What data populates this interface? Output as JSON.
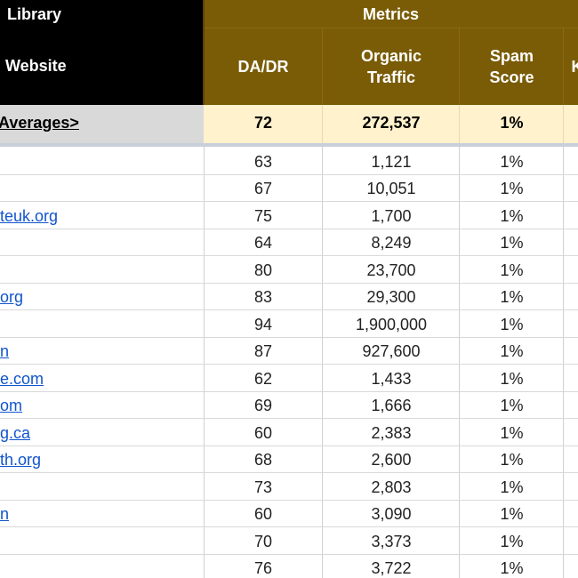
{
  "header": {
    "library_label": "Library",
    "website_label": "Website",
    "metrics_label": "Metrics",
    "columns": [
      {
        "line1": "DA/DR",
        "line2": ""
      },
      {
        "line1": "Organic",
        "line2": "Traffic"
      },
      {
        "line1": "Spam",
        "line2": "Score"
      },
      {
        "line1": "K",
        "line2": ""
      }
    ]
  },
  "averages": {
    "label": "Averages>",
    "da_dr": "72",
    "organic_traffic": "272,537",
    "spam_score": "1%"
  },
  "rows": [
    {
      "website": "",
      "da_dr": "63",
      "traffic": "1,121",
      "spam": "1%"
    },
    {
      "website": "",
      "da_dr": "67",
      "traffic": "10,051",
      "spam": "1%"
    },
    {
      "website": "teuk.org",
      "da_dr": "75",
      "traffic": "1,700",
      "spam": "1%"
    },
    {
      "website": "",
      "da_dr": "64",
      "traffic": "8,249",
      "spam": "1%"
    },
    {
      "website": "",
      "da_dr": "80",
      "traffic": "23,700",
      "spam": "1%"
    },
    {
      "website": "org",
      "da_dr": "83",
      "traffic": "29,300",
      "spam": "1%"
    },
    {
      "website": "",
      "da_dr": "94",
      "traffic": "1,900,000",
      "spam": "1%"
    },
    {
      "website": "n",
      "da_dr": "87",
      "traffic": "927,600",
      "spam": "1%"
    },
    {
      "website": "e.com",
      "da_dr": "62",
      "traffic": "1,433",
      "spam": "1%"
    },
    {
      "website": "om",
      "da_dr": "69",
      "traffic": "1,666",
      "spam": "1%"
    },
    {
      "website": "g.ca",
      "da_dr": "60",
      "traffic": "2,383",
      "spam": "1%"
    },
    {
      "website": "th.org",
      "da_dr": "68",
      "traffic": "2,600",
      "spam": "1%"
    },
    {
      "website": "",
      "da_dr": "73",
      "traffic": "2,803",
      "spam": "1%"
    },
    {
      "website": "n",
      "da_dr": "60",
      "traffic": "3,090",
      "spam": "1%"
    },
    {
      "website": "",
      "da_dr": "70",
      "traffic": "3,373",
      "spam": "1%"
    },
    {
      "website": "",
      "da_dr": "76",
      "traffic": "3,722",
      "spam": "1%"
    }
  ],
  "colors": {
    "header_black": "#000000",
    "header_gold": "#7a5c06",
    "averages_gray": "#d9d9d9",
    "averages_cream": "#fff2cc",
    "link_blue": "#1155cc"
  }
}
